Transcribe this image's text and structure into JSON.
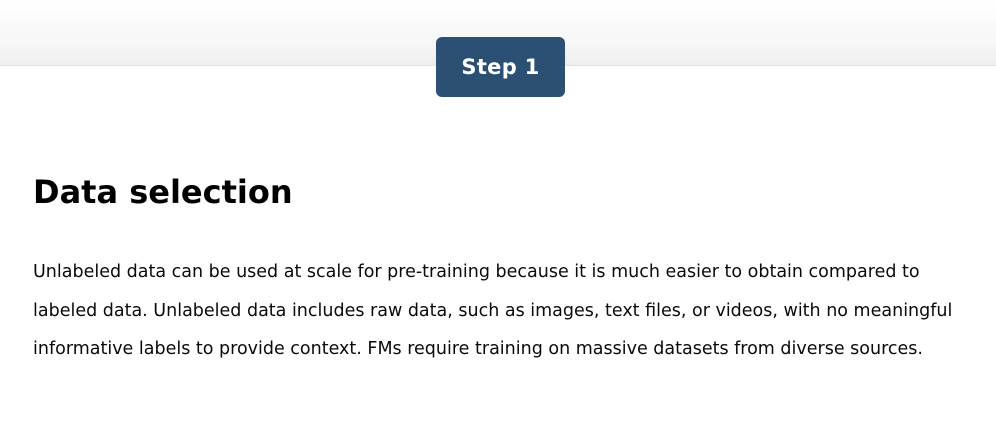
{
  "step_badge": {
    "label": "Step 1",
    "background_color": "#2b5073",
    "text_color": "#ffffff"
  },
  "section": {
    "title": "Data selection",
    "body": "Unlabeled data can be used at scale for pre-training because it is much easier to obtain compared to labeled data. Unlabeled data includes raw data, such as images, text files, or videos, with no meaningful informative labels to provide context. FMs require training on massive datasets from diverse sources."
  }
}
